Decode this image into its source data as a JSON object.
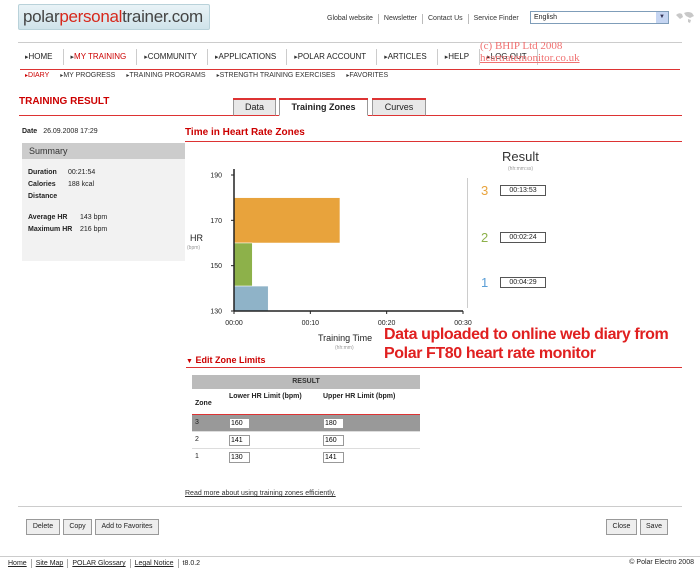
{
  "header": {
    "logo": {
      "part1": "polar",
      "part2": "personal",
      "part3": "trainer.com"
    },
    "top_links": [
      "Global website",
      "Newsletter",
      "Contact Us",
      "Service Finder"
    ],
    "language": "English"
  },
  "nav": {
    "main": [
      {
        "label": "HOME",
        "active": false
      },
      {
        "label": "MY TRAINING",
        "active": true
      },
      {
        "label": "COMMUNITY",
        "active": false
      },
      {
        "label": "APPLICATIONS",
        "active": false
      },
      {
        "label": "POLAR ACCOUNT",
        "active": false
      },
      {
        "label": "ARTICLES",
        "active": false
      },
      {
        "label": "HELP",
        "active": false
      },
      {
        "label": "LOG OUT",
        "active": false
      }
    ],
    "sub": [
      {
        "label": "DIARY",
        "active": true
      },
      {
        "label": "MY PROGRESS",
        "active": false
      },
      {
        "label": "TRAINING PROGRAMS",
        "active": false
      },
      {
        "label": "STRENGTH TRAINING EXERCISES",
        "active": false
      },
      {
        "label": "FAVORITES",
        "active": false
      }
    ]
  },
  "watermark": {
    "line1": "(c) BHIP Ltd 2008",
    "line2": "heartratemonitor.co.uk"
  },
  "page": {
    "title": "TRAINING RESULT",
    "tabs": [
      {
        "label": "Data",
        "active": false
      },
      {
        "label": "Training Zones",
        "active": true
      },
      {
        "label": "Curves",
        "active": false
      }
    ]
  },
  "summary": {
    "date_label": "Date",
    "date_value": "26.09.2008 17:29",
    "heading": "Summary",
    "duration_label": "Duration",
    "duration_value": "00:21:54",
    "calories_label": "Calories",
    "calories_value": "188 kcal",
    "distance_label": "Distance",
    "distance_value": "",
    "avg_hr_label": "Average HR",
    "avg_hr_value": "143 bpm",
    "max_hr_label": "Maximum HR",
    "max_hr_value": "216 bpm"
  },
  "chart_title": "Time in Heart Rate Zones",
  "chart_data": {
    "type": "bar",
    "orientation": "horizontal",
    "ylabel": "HR",
    "ylabel_unit": "(bpm)",
    "xlabel": "Training Time",
    "xlabel_unit": "(hh:mm)",
    "y_ticks": [
      "190",
      "170",
      "150",
      "130"
    ],
    "x_ticks": [
      "00:00",
      "00:10",
      "00:20",
      "00:30"
    ],
    "xlim_minutes": [
      0,
      30
    ],
    "ylim_bpm": [
      130,
      190
    ],
    "zones": [
      {
        "zone": "3",
        "hr_low": 160,
        "hr_high": 180,
        "minutes": 13.88,
        "color": "#e8a33c"
      },
      {
        "zone": "2",
        "hr_low": 141,
        "hr_high": 160,
        "minutes": 2.4,
        "color": "#8db14a"
      },
      {
        "zone": "1",
        "hr_low": 130,
        "hr_high": 141,
        "minutes": 4.48,
        "color": "#8fb3c8"
      }
    ],
    "grid": false
  },
  "result": {
    "heading": "Result",
    "unit": "(hh:mm:ss)",
    "zones": [
      {
        "zone": "3",
        "time": "00:13:53",
        "color": "#e8a33c"
      },
      {
        "zone": "2",
        "time": "00:02:24",
        "color": "#8db14a"
      },
      {
        "zone": "1",
        "time": "00:04:29",
        "color": "#5a9ed6"
      }
    ]
  },
  "annotation": {
    "line1": "Data uploaded to online web diary from",
    "line2": "Polar FT80 heart rate monitor"
  },
  "edit_limits": {
    "title": "Edit Zone Limits",
    "table_head": "RESULT",
    "col_zone": "Zone",
    "col_lower": "Lower HR Limit (bpm)",
    "col_upper": "Upper HR Limit (bpm)",
    "rows": [
      {
        "zone": "3",
        "lower": "160",
        "upper": "180",
        "selected": true
      },
      {
        "zone": "2",
        "lower": "141",
        "upper": "160",
        "selected": false
      },
      {
        "zone": "1",
        "lower": "130",
        "upper": "141",
        "selected": false
      }
    ],
    "read_more": "Read more about using training zones efficiently."
  },
  "buttons": {
    "delete": "Delete",
    "copy": "Copy",
    "favorites": "Add to Favorites",
    "close": "Close",
    "save": "Save"
  },
  "footer": {
    "links": [
      "Home",
      "Site Map",
      "POLAR Glossary",
      "Legal Notice",
      "t8.0.2"
    ],
    "copyright": "© Polar Electro 2008"
  }
}
